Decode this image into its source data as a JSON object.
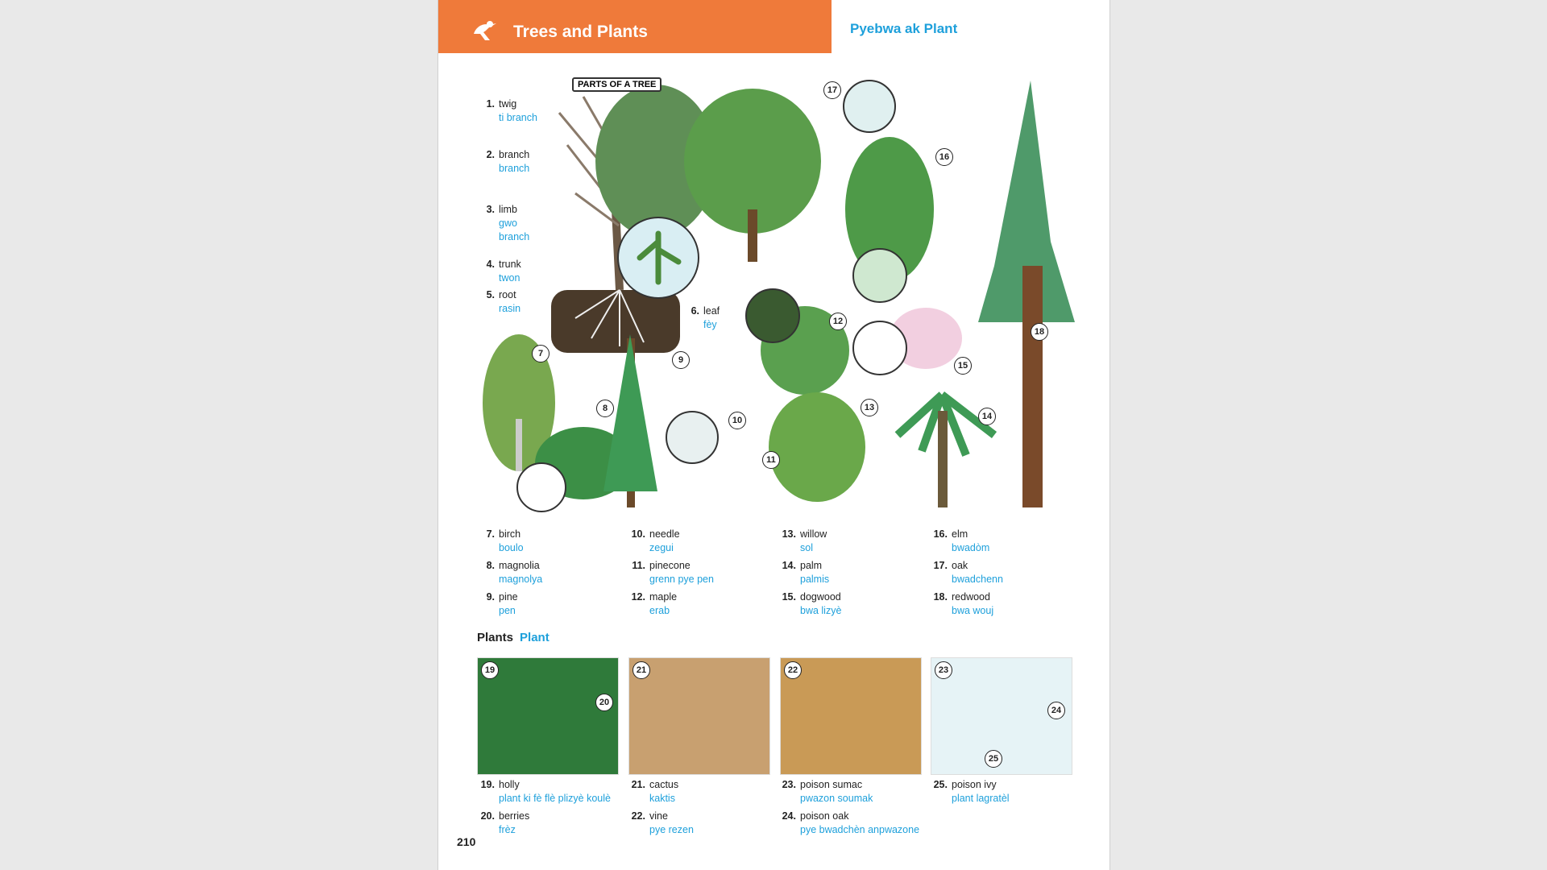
{
  "header": {
    "title": "Trees and Plants",
    "subtitle": "Pyebwa ak Plant"
  },
  "parts_label": "PARTS OF A TREE",
  "parts": [
    {
      "num": "1.",
      "en": "twig",
      "ht": "ti branch"
    },
    {
      "num": "2.",
      "en": "branch",
      "ht": "branch"
    },
    {
      "num": "3.",
      "en": "limb",
      "ht": "gwo branch"
    },
    {
      "num": "4.",
      "en": "trunk",
      "ht": "twon"
    },
    {
      "num": "5.",
      "en": "root",
      "ht": "rasin"
    },
    {
      "num": "6.",
      "en": "leaf",
      "ht": "fèy"
    }
  ],
  "trees": [
    {
      "num": "7.",
      "en": "birch",
      "ht": "boulo"
    },
    {
      "num": "8.",
      "en": "magnolia",
      "ht": "magnolya"
    },
    {
      "num": "9.",
      "en": "pine",
      "ht": "pen"
    },
    {
      "num": "10.",
      "en": "needle",
      "ht": "zegui"
    },
    {
      "num": "11.",
      "en": "pinecone",
      "ht": "grenn pye pen"
    },
    {
      "num": "12.",
      "en": "maple",
      "ht": "erab"
    },
    {
      "num": "13.",
      "en": "willow",
      "ht": "sol"
    },
    {
      "num": "14.",
      "en": "palm",
      "ht": "palmis"
    },
    {
      "num": "15.",
      "en": "dogwood",
      "ht": "bwa lizyè"
    },
    {
      "num": "16.",
      "en": "elm",
      "ht": "bwadòm"
    },
    {
      "num": "17.",
      "en": "oak",
      "ht": "bwadchenn"
    },
    {
      "num": "18.",
      "en": "redwood",
      "ht": "bwa wouj"
    }
  ],
  "plants_heading": {
    "en": "Plants",
    "ht": "Plant"
  },
  "plants": [
    {
      "num": "19.",
      "en": "holly",
      "ht": "plant ki fè flè plizyè koulè"
    },
    {
      "num": "20.",
      "en": "berries",
      "ht": "frèz"
    },
    {
      "num": "21.",
      "en": "cactus",
      "ht": "kaktis"
    },
    {
      "num": "22.",
      "en": "vine",
      "ht": "pye rezen"
    },
    {
      "num": "23.",
      "en": "poison sumac",
      "ht": "pwazon soumak"
    },
    {
      "num": "24.",
      "en": "poison oak",
      "ht": "pye bwadchèn anpwazone"
    },
    {
      "num": "25.",
      "en": "poison ivy",
      "ht": "plant lagratèl"
    }
  ],
  "callouts": [
    "7",
    "8",
    "9",
    "10",
    "11",
    "12",
    "13",
    "14",
    "15",
    "16",
    "17",
    "18",
    "19",
    "20",
    "21",
    "22",
    "23",
    "24",
    "25"
  ],
  "page_number": "210",
  "colors": {
    "header": "#ef7a3a",
    "blue": "#1ea0db",
    "leaf": "#3e9a4a"
  }
}
